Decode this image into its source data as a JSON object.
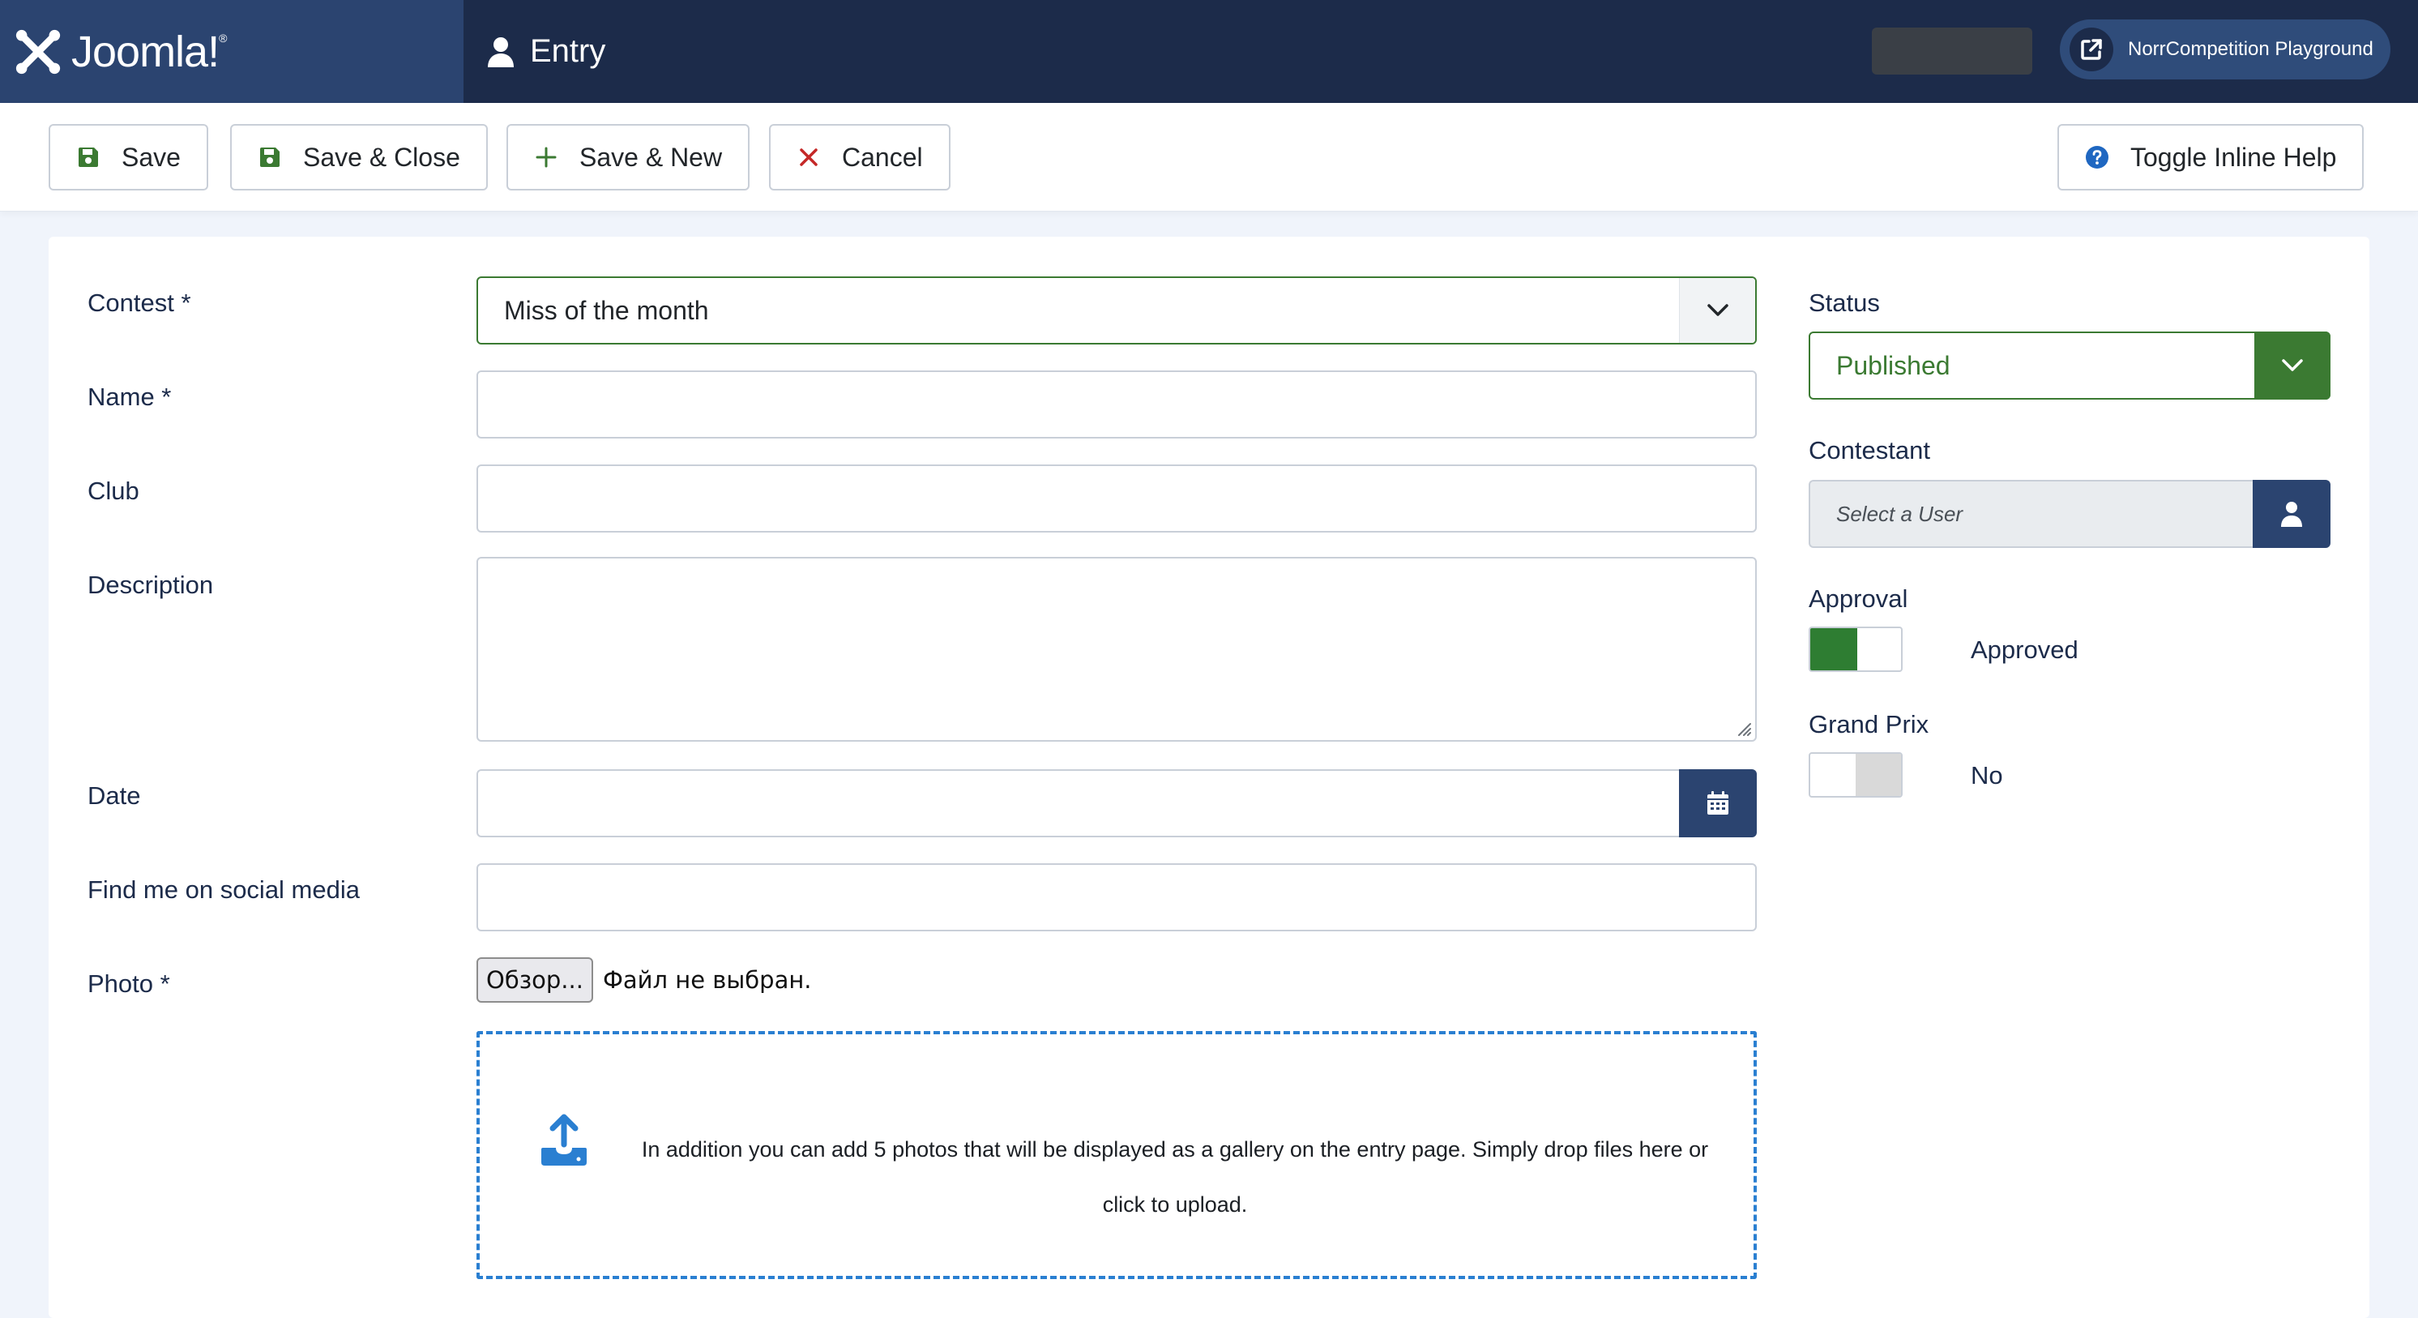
{
  "header": {
    "brand": "Joomla!",
    "page_title": "Entry",
    "site_link_label": "NorrCompetition Playground"
  },
  "toolbar": {
    "save_label": "Save",
    "save_close_label": "Save & Close",
    "save_new_label": "Save & New",
    "cancel_label": "Cancel",
    "help_label": "Toggle Inline Help"
  },
  "form": {
    "contest": {
      "label": "Contest *",
      "value": "Miss of the month"
    },
    "name": {
      "label": "Name *",
      "value": ""
    },
    "club": {
      "label": "Club",
      "value": ""
    },
    "description": {
      "label": "Description",
      "value": ""
    },
    "date": {
      "label": "Date",
      "value": ""
    },
    "social": {
      "label": "Find me on social media",
      "value": ""
    },
    "photo": {
      "label": "Photo *",
      "browse_label": "Обзор...",
      "no_file_text": "Файл не выбран."
    },
    "dropzone_text": "In addition you can add 5 photos that will be displayed as a gallery on the entry page. Simply drop files here or click to upload."
  },
  "side": {
    "status": {
      "label": "Status",
      "value": "Published"
    },
    "contestant": {
      "label": "Contestant",
      "placeholder": "Select a User"
    },
    "approval": {
      "label": "Approval",
      "value": "Approved",
      "on": true
    },
    "grand_prix": {
      "label": "Grand Prix",
      "value": "No",
      "on": false
    }
  },
  "colors": {
    "header_bg": "#1c2b4a",
    "brand_bg": "#2b4470",
    "accent_green": "#3b7a32",
    "primary_blue": "#2b4470",
    "dropzone_blue": "#2a7fd1",
    "cancel_red": "#c52827"
  },
  "icons": {
    "brand": "joomla-logo-icon",
    "title": "user-icon",
    "site_link": "external-link-icon",
    "save": "floppy-disk-icon",
    "save_new": "plus-icon",
    "cancel": "x-icon",
    "help": "question-circle-icon",
    "select": "chevron-down-icon",
    "date": "calendar-icon",
    "user": "user-icon",
    "upload": "upload-icon"
  }
}
